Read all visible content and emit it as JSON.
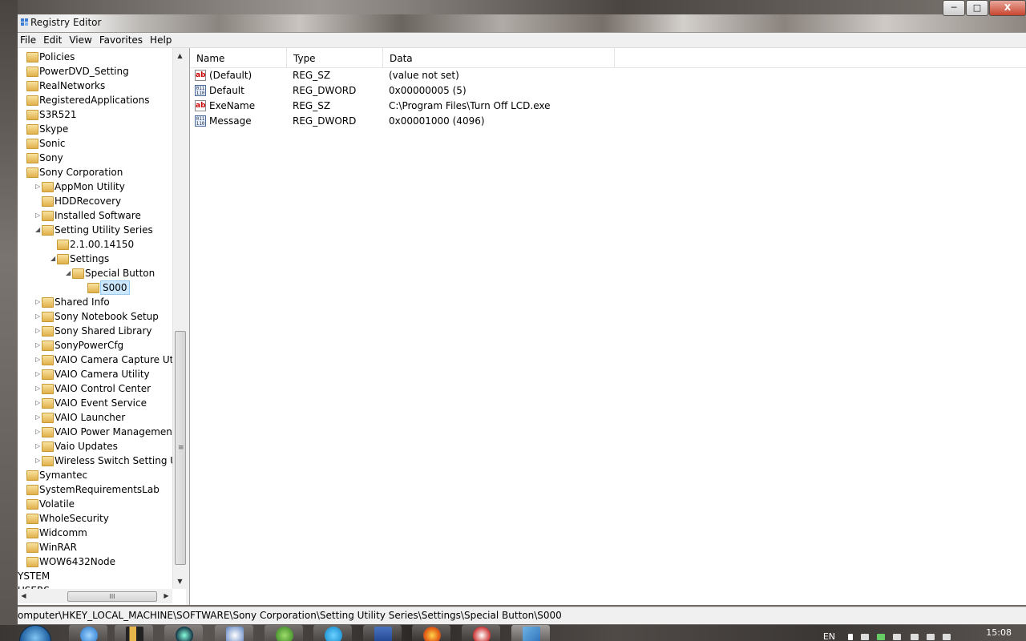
{
  "window": {
    "title": "Registry Editor",
    "buttons": {
      "minimize": "─",
      "maximize": "□",
      "close": "X"
    }
  },
  "menu": [
    "File",
    "Edit",
    "View",
    "Favorites",
    "Help"
  ],
  "tree": {
    "nodes": [
      {
        "label": "Policies",
        "level": 0,
        "expander": ""
      },
      {
        "label": "PowerDVD_Setting",
        "level": 0,
        "expander": ""
      },
      {
        "label": "RealNetworks",
        "level": 0,
        "expander": ""
      },
      {
        "label": "RegisteredApplications",
        "level": 0,
        "expander": ""
      },
      {
        "label": "S3R521",
        "level": 0,
        "expander": ""
      },
      {
        "label": "Skype",
        "level": 0,
        "expander": ""
      },
      {
        "label": "Sonic",
        "level": 0,
        "expander": ""
      },
      {
        "label": "Sony",
        "level": 0,
        "expander": ""
      },
      {
        "label": "Sony Corporation",
        "level": 0,
        "expander": ""
      },
      {
        "label": "AppMon Utility",
        "level": 1,
        "expander": "▷"
      },
      {
        "label": "HDDRecovery",
        "level": 1,
        "expander": ""
      },
      {
        "label": "Installed Software",
        "level": 1,
        "expander": "▷"
      },
      {
        "label": "Setting Utility Series",
        "level": 1,
        "expander": "◢"
      },
      {
        "label": "2.1.00.14150",
        "level": 2,
        "expander": ""
      },
      {
        "label": "Settings",
        "level": 2,
        "expander": "◢"
      },
      {
        "label": "Special Button",
        "level": 3,
        "expander": "◢"
      },
      {
        "label": "S000",
        "level": 4,
        "expander": "",
        "selected": true
      },
      {
        "label": "Shared Info",
        "level": 1,
        "expander": "▷"
      },
      {
        "label": "Sony Notebook Setup",
        "level": 1,
        "expander": "▷"
      },
      {
        "label": "Sony Shared Library",
        "level": 1,
        "expander": "▷"
      },
      {
        "label": "SonyPowerCfg",
        "level": 1,
        "expander": "▷"
      },
      {
        "label": "VAIO Camera Capture Utility",
        "level": 1,
        "expander": "▷"
      },
      {
        "label": "VAIO Camera Utility",
        "level": 1,
        "expander": "▷"
      },
      {
        "label": "VAIO Control Center",
        "level": 1,
        "expander": "▷"
      },
      {
        "label": "VAIO Event Service",
        "level": 1,
        "expander": "▷"
      },
      {
        "label": "VAIO Launcher",
        "level": 1,
        "expander": "▷"
      },
      {
        "label": "VAIO Power Management",
        "level": 1,
        "expander": "▷"
      },
      {
        "label": "Vaio Updates",
        "level": 1,
        "expander": "▷"
      },
      {
        "label": "Wireless Switch Setting Utility",
        "level": 1,
        "expander": "▷"
      },
      {
        "label": "Symantec",
        "level": 0,
        "expander": ""
      },
      {
        "label": "SystemRequirementsLab",
        "level": 0,
        "expander": ""
      },
      {
        "label": "Volatile",
        "level": 0,
        "expander": ""
      },
      {
        "label": "WholeSecurity",
        "level": 0,
        "expander": ""
      },
      {
        "label": "Widcomm",
        "level": 0,
        "expander": ""
      },
      {
        "label": "WinRAR",
        "level": 0,
        "expander": ""
      },
      {
        "label": "WOW6432Node",
        "level": 0,
        "expander": ""
      },
      {
        "label": "YSTEM",
        "level": -1,
        "expander": ""
      },
      {
        "label": "USERS",
        "level": -1,
        "expander": ""
      }
    ],
    "scroll": {
      "up": "▲",
      "down": "▼",
      "left": "◀",
      "right": "▶",
      "grip": "≡",
      "hgrip": "III"
    }
  },
  "list": {
    "columns": [
      "Name",
      "Type",
      "Data"
    ],
    "rows": [
      {
        "icon": "string-value-icon",
        "name": "(Default)",
        "type": "REG_SZ",
        "data": "(value not set)"
      },
      {
        "icon": "dword-value-icon",
        "name": "Default",
        "type": "REG_DWORD",
        "data": "0x00000005 (5)"
      },
      {
        "icon": "string-value-icon",
        "name": "ExeName",
        "type": "REG_SZ",
        "data": "C:\\Program Files\\Turn Off LCD.exe"
      },
      {
        "icon": "dword-value-icon",
        "name": "Message",
        "type": "REG_DWORD",
        "data": "0x00001000 (4096)"
      }
    ]
  },
  "statusbar": {
    "path": "omputer\\HKEY_LOCAL_MACHINE\\SOFTWARE\\Sony Corporation\\Setting Utility Series\\Settings\\Special Button\\S000"
  },
  "taskbar": {
    "lang": "EN",
    "clock": "15:08"
  }
}
